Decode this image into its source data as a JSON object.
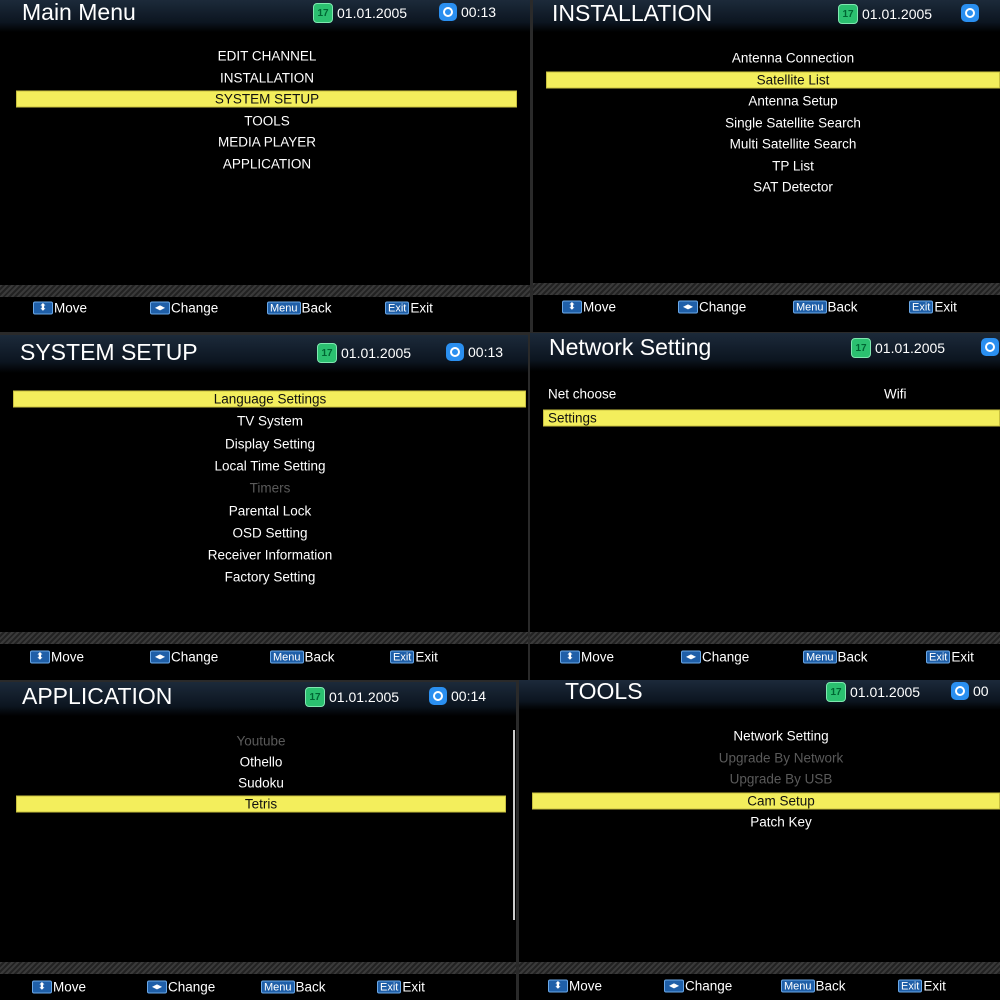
{
  "date": "01.01.2005",
  "calendar_day": "17",
  "footer": {
    "move": "Move",
    "change": "Change",
    "menu_key": "Menu",
    "back": "Back",
    "exit_key": "Exit",
    "exit": "Exit"
  },
  "colors": {
    "highlight": "#f3ee5c",
    "disabled": "#5a5a5a",
    "key": "#1f5fa8"
  },
  "panels": [
    {
      "title": "Main Menu",
      "time": "00:13",
      "items": [
        {
          "label": "EDIT CHANNEL"
        },
        {
          "label": "INSTALLATION"
        },
        {
          "label": "SYSTEM SETUP",
          "selected": true
        },
        {
          "label": "TOOLS"
        },
        {
          "label": "MEDIA PLAYER"
        },
        {
          "label": "APPLICATION"
        }
      ]
    },
    {
      "title": "INSTALLATION",
      "time": "",
      "items": [
        {
          "label": "Antenna Connection"
        },
        {
          "label": "Satellite List",
          "selected": true
        },
        {
          "label": "Antenna Setup"
        },
        {
          "label": "Single Satellite Search"
        },
        {
          "label": "Multi Satellite Search"
        },
        {
          "label": "TP List"
        },
        {
          "label": "SAT Detector"
        }
      ]
    },
    {
      "title": "SYSTEM SETUP",
      "time": "00:13",
      "items": [
        {
          "label": "Language Settings",
          "selected": true
        },
        {
          "label": "TV System"
        },
        {
          "label": "Display Setting"
        },
        {
          "label": "Local Time Setting"
        },
        {
          "label": "Timers",
          "disabled": true
        },
        {
          "label": "Parental Lock"
        },
        {
          "label": "OSD Setting"
        },
        {
          "label": "Receiver Information"
        },
        {
          "label": "Factory Setting"
        }
      ]
    },
    {
      "title": "Network Setting",
      "time": "",
      "items": [
        {
          "label": "Net choose",
          "value": "Wifi"
        },
        {
          "label": "Settings",
          "selected": true
        }
      ]
    },
    {
      "title": "APPLICATION",
      "time": "00:14",
      "items": [
        {
          "label": "Youtube",
          "disabled": true
        },
        {
          "label": "Othello"
        },
        {
          "label": "Sudoku"
        },
        {
          "label": "Tetris",
          "selected": true
        }
      ]
    },
    {
      "title": "TOOLS",
      "time": "00",
      "items": [
        {
          "label": "Network Setting"
        },
        {
          "label": "Upgrade By Network",
          "disabled": true
        },
        {
          "label": "Upgrade By USB",
          "disabled": true
        },
        {
          "label": "Cam Setup",
          "selected": true
        },
        {
          "label": "Patch Key"
        }
      ]
    }
  ]
}
